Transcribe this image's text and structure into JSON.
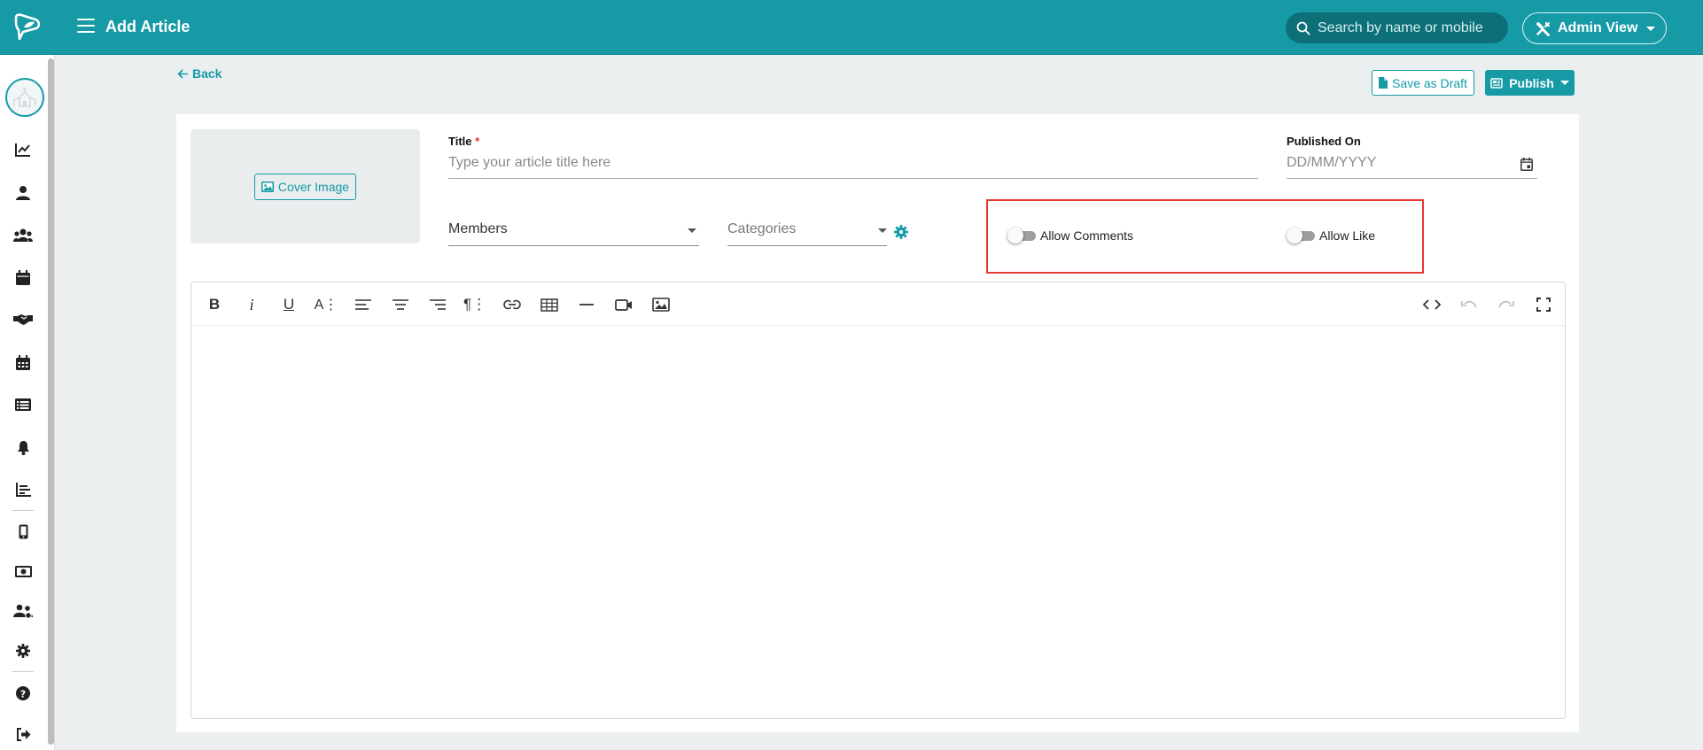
{
  "header": {
    "title": "Add Article",
    "search_placeholder": "Search by name or mobile",
    "view_label": "Admin View"
  },
  "colors": {
    "brand": "#159aa6",
    "highlight": "#e53935"
  },
  "sidebar": {
    "items": [
      {
        "icon": "chart-line-icon"
      },
      {
        "icon": "user-icon"
      },
      {
        "icon": "users-icon"
      },
      {
        "icon": "calendar-icon"
      },
      {
        "icon": "handshake-icon"
      },
      {
        "icon": "calendar-grid-icon"
      },
      {
        "icon": "list-icon"
      },
      {
        "icon": "bell-icon"
      },
      {
        "icon": "bar-chart-icon"
      },
      {
        "icon": "mobile-icon"
      },
      {
        "icon": "money-icon"
      },
      {
        "icon": "group-icon"
      },
      {
        "icon": "settings-icon"
      },
      {
        "icon": "help-icon"
      },
      {
        "icon": "logout-icon"
      }
    ]
  },
  "actions": {
    "back_label": "Back",
    "save_draft_label": "Save as Draft",
    "publish_label": "Publish"
  },
  "form": {
    "cover_image_label": "Cover Image",
    "title_label": "Title",
    "title_required_mark": "*",
    "title_placeholder": "Type your article title here",
    "published_on_label": "Published On",
    "published_on_placeholder": "DD/MM/YYYY",
    "members_value": "Members",
    "categories_value": "Categories",
    "allow_comments_label": "Allow Comments",
    "allow_comments_on": false,
    "allow_like_label": "Allow Like",
    "allow_like_on": false
  },
  "editor": {
    "toolbar": [
      "bold-icon",
      "italic-icon",
      "underline-icon",
      "font-size-icon",
      "align-left-icon",
      "align-center-icon",
      "align-right-icon",
      "paragraph-icon",
      "link-icon",
      "table-icon",
      "horizontal-rule-icon",
      "video-icon",
      "image-icon",
      "code-view-icon",
      "undo-icon",
      "redo-icon",
      "fullscreen-icon"
    ]
  }
}
